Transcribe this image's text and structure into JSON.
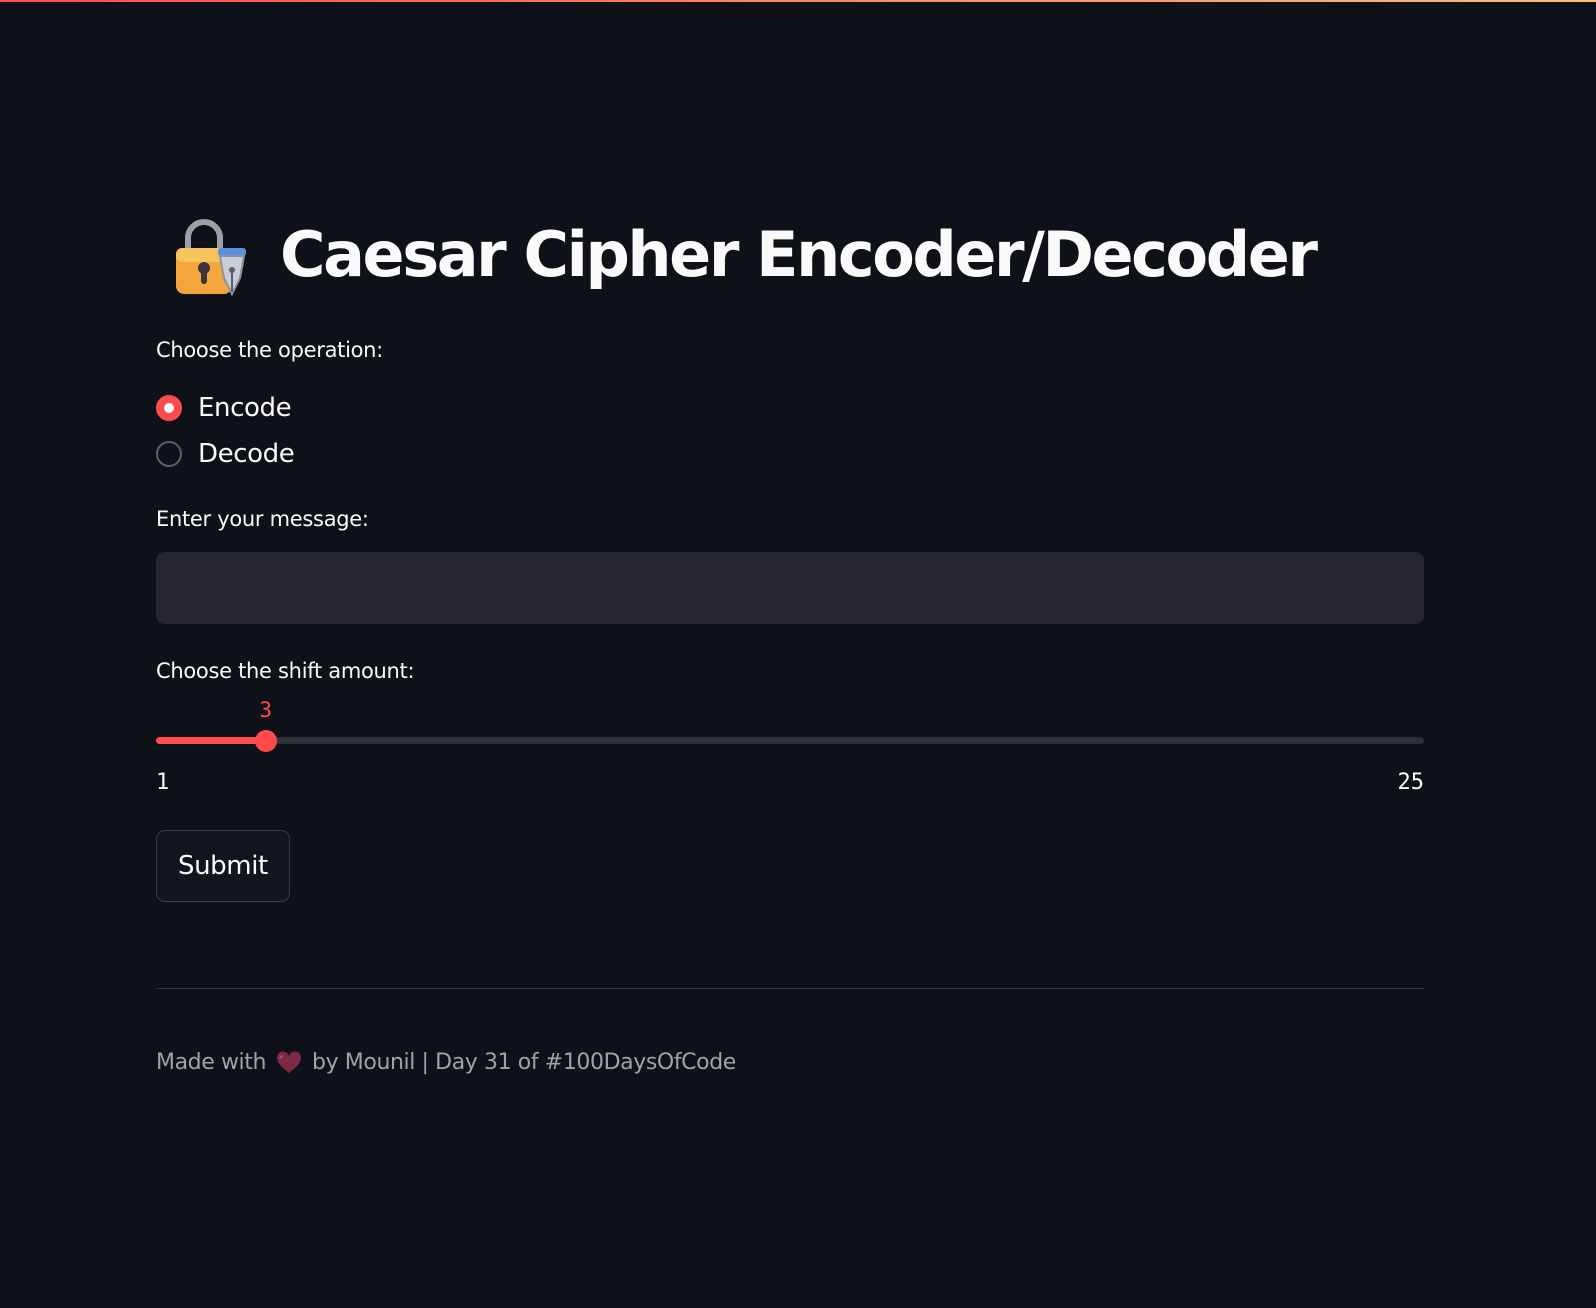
{
  "page": {
    "title": "Caesar Cipher Encoder/Decoder",
    "title_icon": "lock-with-pen-icon",
    "accent_color": "#ff4b4b",
    "background_color": "#0e1117"
  },
  "operation": {
    "label": "Choose the operation:",
    "options": [
      "Encode",
      "Decode"
    ],
    "selected": "Encode"
  },
  "message": {
    "label": "Enter your message:",
    "value": "",
    "placeholder": ""
  },
  "shift": {
    "label": "Choose the shift amount:",
    "min": 1,
    "max": 25,
    "value": 3,
    "value_text": "3",
    "min_text": "1",
    "max_text": "25"
  },
  "submit": {
    "label": "Submit"
  },
  "footer": {
    "prefix": "Made with",
    "icon": "heart-icon",
    "suffix": "by Mounil | Day 31 of #100DaysOfCode"
  }
}
